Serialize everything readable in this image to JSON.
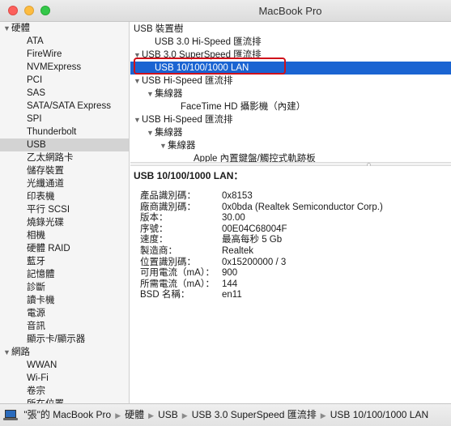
{
  "window": {
    "title": "MacBook Pro"
  },
  "sidebar": [
    {
      "label": "硬體",
      "type": "category",
      "expanded": true
    },
    {
      "label": "ATA",
      "type": "item"
    },
    {
      "label": "FireWire",
      "type": "item"
    },
    {
      "label": "NVMExpress",
      "type": "item"
    },
    {
      "label": "PCI",
      "type": "item"
    },
    {
      "label": "SAS",
      "type": "item"
    },
    {
      "label": "SATA/SATA Express",
      "type": "item"
    },
    {
      "label": "SPI",
      "type": "item"
    },
    {
      "label": "Thunderbolt",
      "type": "item"
    },
    {
      "label": "USB",
      "type": "item",
      "selected": true
    },
    {
      "label": "乙太網路卡",
      "type": "item"
    },
    {
      "label": "儲存裝置",
      "type": "item"
    },
    {
      "label": "光纖通道",
      "type": "item"
    },
    {
      "label": "印表機",
      "type": "item"
    },
    {
      "label": "平行 SCSI",
      "type": "item"
    },
    {
      "label": "燒錄光碟",
      "type": "item"
    },
    {
      "label": "相機",
      "type": "item"
    },
    {
      "label": "硬體 RAID",
      "type": "item"
    },
    {
      "label": "藍牙",
      "type": "item"
    },
    {
      "label": "記憶體",
      "type": "item"
    },
    {
      "label": "診斷",
      "type": "item"
    },
    {
      "label": "讀卡機",
      "type": "item"
    },
    {
      "label": "電源",
      "type": "item"
    },
    {
      "label": "音訊",
      "type": "item"
    },
    {
      "label": "顯示卡/顯示器",
      "type": "item"
    },
    {
      "label": "網路",
      "type": "category",
      "expanded": true
    },
    {
      "label": "WWAN",
      "type": "item"
    },
    {
      "label": "Wi-Fi",
      "type": "item"
    },
    {
      "label": "卷宗",
      "type": "item"
    },
    {
      "label": "所在位置",
      "type": "item"
    }
  ],
  "tree": [
    {
      "label": "USB 裝置樹",
      "level": 0,
      "arrow": false
    },
    {
      "label": "USB 3.0 Hi-Speed 匯流排",
      "level": 1,
      "arrow": false
    },
    {
      "label": "USB 3.0 SuperSpeed 匯流排",
      "level": 0,
      "arrow": true
    },
    {
      "label": "USB 10/100/1000 LAN",
      "level": 1,
      "arrow": false,
      "selected": true
    },
    {
      "label": "USB Hi-Speed 匯流排",
      "level": 0,
      "arrow": true
    },
    {
      "label": "集線器",
      "level": 1,
      "arrow": true
    },
    {
      "label": "FaceTime HD 攝影機（內建）",
      "level": 3,
      "arrow": false
    },
    {
      "label": "USB Hi-Speed 匯流排",
      "level": 0,
      "arrow": true
    },
    {
      "label": "集線器",
      "level": 1,
      "arrow": true
    },
    {
      "label": "集線器",
      "level": 2,
      "arrow": true
    },
    {
      "label": "Apple 內置鍵盤/觸控式軌跡板",
      "level": 4,
      "arrow": false
    }
  ],
  "detail": {
    "title": "USB 10/100/1000 LAN：",
    "rows": [
      {
        "key": "產品識別碼：",
        "value": "0x8153"
      },
      {
        "key": "廠商識別碼：",
        "value": "0x0bda  (Realtek Semiconductor Corp.)"
      },
      {
        "key": "版本：",
        "value": "30.00"
      },
      {
        "key": "序號：",
        "value": "00E04C68004F"
      },
      {
        "key": "速度：",
        "value": "最高每秒 5 Gb"
      },
      {
        "key": "製造商：",
        "value": "Realtek"
      },
      {
        "key": "位置識別碼：",
        "value": "0x15200000 / 3"
      },
      {
        "key": "可用電流（mA）：",
        "value": "900"
      },
      {
        "key": "所需電流（mA）：",
        "value": "144"
      },
      {
        "key": "BSD 名稱：",
        "value": "en11"
      }
    ]
  },
  "statusbar": {
    "crumbs": [
      "\"張\"的 MacBook Pro",
      "硬體",
      "USB",
      "USB 3.0 SuperSpeed 匯流排",
      "USB 10/100/1000 LAN"
    ]
  },
  "colors": {
    "selection": "#1a64d2",
    "highlight_box": "#d0111b"
  }
}
